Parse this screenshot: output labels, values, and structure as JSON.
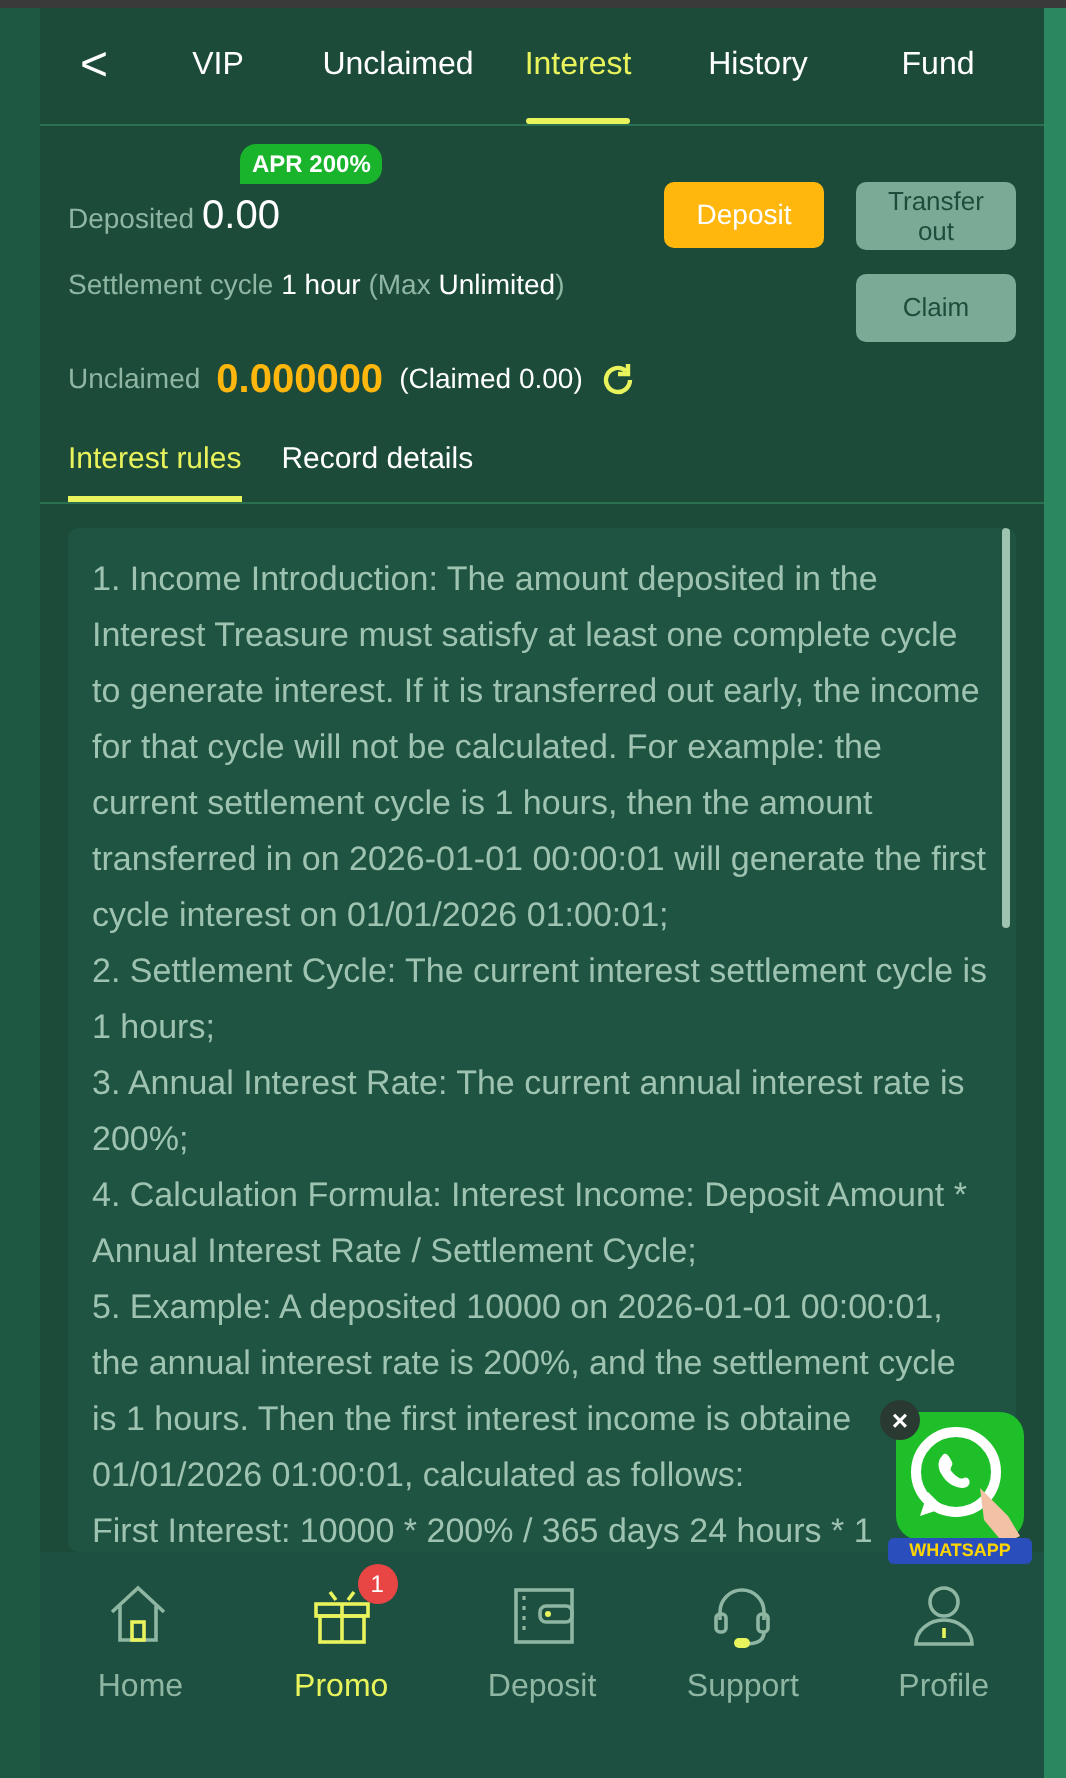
{
  "header": {
    "back": "<",
    "tabs": [
      {
        "label": "VIP",
        "selected": false
      },
      {
        "label": "Unclaimed",
        "selected": false
      },
      {
        "label": "Interest",
        "selected": true
      },
      {
        "label": "History",
        "selected": false
      },
      {
        "label": "Fund",
        "selected": false
      }
    ]
  },
  "summary": {
    "apr_badge": "APR 200%",
    "deposited_label": "Deposited",
    "deposited_value": "0.00",
    "deposit_button": "Deposit",
    "transfer_button": "Transfer out",
    "cycle_label": "Settlement cycle",
    "cycle_value": "1 hour",
    "max_open": "(Max",
    "max_value": "Unlimited",
    "max_close": ")",
    "claim_button": "Claim",
    "unclaimed_label": "Unclaimed",
    "unclaimed_value": "0.000000",
    "claimed_text": "(Claimed 0.00)"
  },
  "subtabs": [
    {
      "label": "Interest rules",
      "selected": true
    },
    {
      "label": "Record details",
      "selected": false
    }
  ],
  "rules": [
    "1. Income Introduction: The amount deposited in the Interest Treasure must satisfy at least one complete cycle to generate interest. If it is transferred out early, the income for that cycle will not be calculated. For example: the current settlement cycle is 1 hours, then the amount transferred in on 2026-01-01 00:00:01 will generate the first cycle interest on 01/01/2026 01:00:01;",
    "2. Settlement Cycle: The current interest settlement cycle is 1 hours;",
    "3. Annual Interest Rate: The current annual interest rate is 200%;",
    "4. Calculation Formula: Interest Income: Deposit Amount * Annual Interest Rate / Settlement Cycle;",
    "5. Example: A deposited 10000 on 2026-01-01 00:00:01, the annual interest rate is 200%, and the settlement cycle"
  ],
  "example_lines": [
    "is 1 hours. Then the first interest income is obtaine",
    "01/01/2026 01:00:01, calculated as follows:",
    "First Interest: 10000 * 200% / 365 days 24 hours * 1"
  ],
  "chat_widget": {
    "label": "WHATSAPP",
    "close": "×"
  },
  "bottom_nav": [
    {
      "label": "Home",
      "kind": "home",
      "selected": false
    },
    {
      "label": "Promo",
      "kind": "gift",
      "selected": true,
      "badge": "1"
    },
    {
      "label": "Deposit",
      "kind": "wallet",
      "selected": false
    },
    {
      "label": "Support",
      "kind": "headset",
      "selected": false
    },
    {
      "label": "Profile",
      "kind": "person",
      "selected": false
    }
  ]
}
